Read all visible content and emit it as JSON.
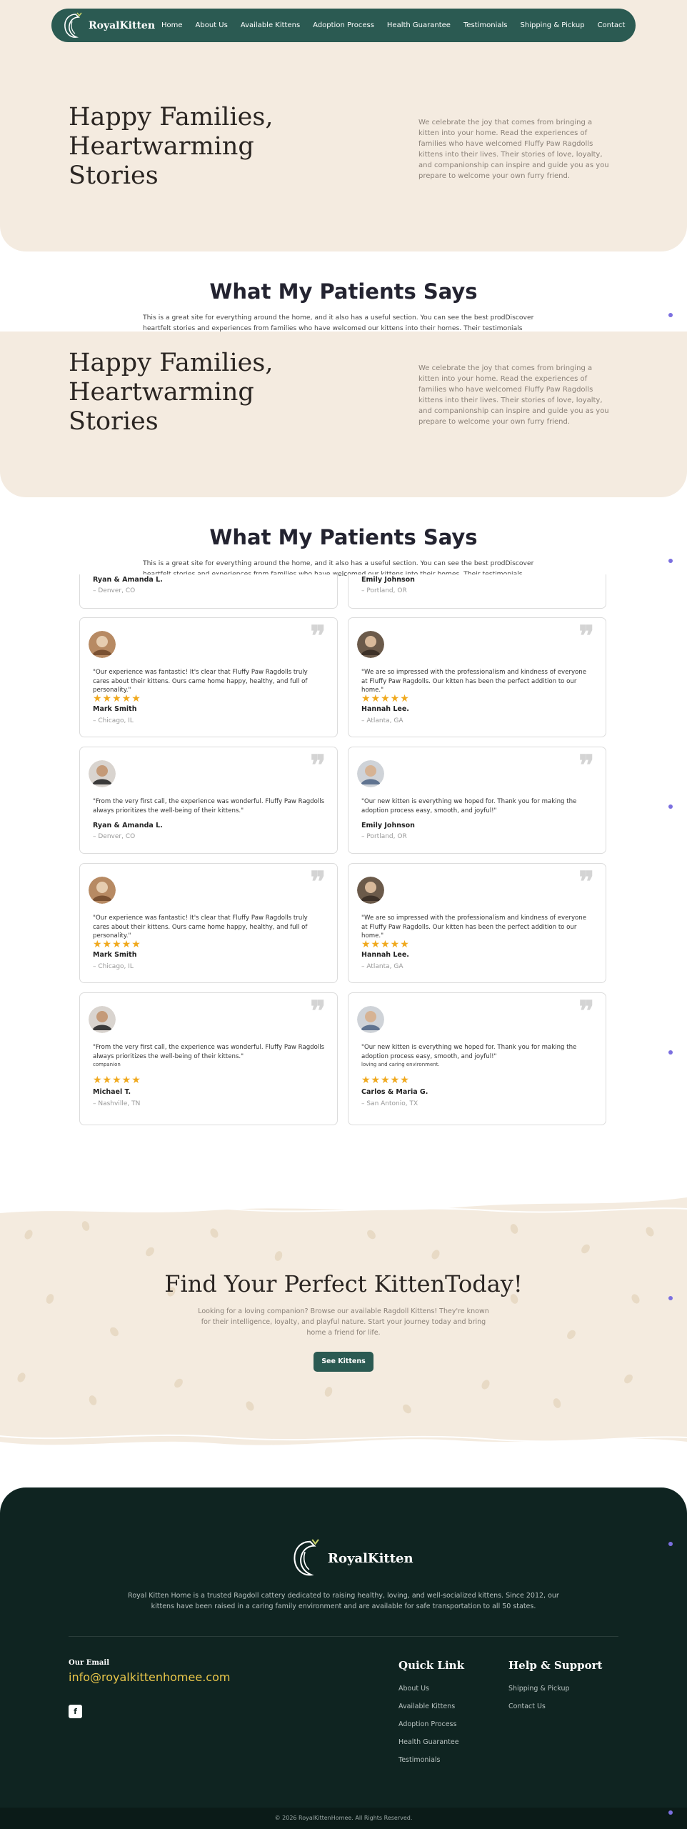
{
  "nav": {
    "brand": "RoyalKitten",
    "items": [
      "Home",
      "About Us",
      "Available Kittens",
      "Adoption Process",
      "Health Guarantee",
      "Testimonials",
      "Shipping & Pickup",
      "Contact"
    ]
  },
  "hero": {
    "title": "Happy Families, Heartwarming Stories",
    "description": "We celebrate the joy that comes from bringing a kitten into your home. Read the experiences of families who have welcomed Fluffy Paw Ragdolls kittens into their lives. Their stories of love, loyalty, and companionship can inspire and guide you as you prepare to welcome your own furry friend."
  },
  "testimonials": {
    "title": "What My Patients Says",
    "description": "This is a great site for everything around the home, and it also has a useful section. You can see the best prodDiscover heartfelt stories and experiences from families who have welcomed our kittens into their homes. Their testimonials highlight the love, joy,",
    "stars": "★★★★★",
    "quote_mark": "❞",
    "partial_top": [
      {
        "name": "Ryan & Amanda L.",
        "location": "– Denver, CO"
      },
      {
        "name": "Emily Johnson",
        "location": "– Portland, OR"
      }
    ],
    "cards": [
      {
        "text": "\"Our experience was fantastic! It's clear that Fluffy Paw Ragdolls truly cares about their kittens. Ours came home happy, healthy, and full of personality.\"",
        "name": "Mark Smith",
        "location": "– Chicago, IL"
      },
      {
        "text": "\"We are so impressed with the professionalism and kindness of everyone at Fluffy Paw Ragdolls. Our kitten has been the perfect addition to our home.\"",
        "name": "Hannah Lee.",
        "location": "– Atlanta, GA"
      },
      {
        "text": "\"From the very first call, the experience was wonderful. Fluffy Paw Ragdolls always prioritizes the well-being of their kittens.\"",
        "name": "Ryan & Amanda L.",
        "location": "– Denver, CO"
      },
      {
        "text": "\"Our new kitten is everything we hoped for. Thank you for making the adoption process easy, smooth, and joyful!\"",
        "name": "Emily Johnson",
        "location": "– Portland, OR"
      },
      {
        "text": "\"Our experience was fantastic! It's clear that Fluffy Paw Ragdolls truly cares about their kittens. Ours came home happy, healthy, and full of personality.\"",
        "name": "Mark Smith",
        "location": "– Chicago, IL"
      },
      {
        "text": "\"We are so impressed with the professionalism and kindness of everyone at Fluffy Paw Ragdolls. Our kitten has been the perfect addition to our home.\"",
        "name": "Hannah Lee.",
        "location": "– Atlanta, GA"
      },
      {
        "text": "\"From the very first call, the experience was wonderful. Fluffy Paw Ragdolls always prioritizes the well-being of their kittens.\"",
        "name": "Michael T.",
        "location": "– Nashville, TN",
        "overlap": "companion"
      },
      {
        "text": "\"Our new kitten is everything we hoped for. Thank you for making the adoption process easy, smooth, and joyful!\"",
        "name": "Carlos & Maria G.",
        "location": "– San Antonio, TX",
        "overlap": "loving and caring environment."
      }
    ]
  },
  "cta": {
    "title": "Find Your Perfect KittenToday!",
    "description": "Looking for a loving companion? Browse our available Ragdoll Kittens! They're known for their intelligence, loyalty, and playful nature. Start your journey today and bring home a friend for life.",
    "button": "See Kittens"
  },
  "footer": {
    "brand": "RoyalKitten",
    "about": "Royal Kitten Home is a trusted Ragdoll cattery dedicated to raising healthy, loving, and well-socialized kittens. Since 2012, our kittens have been raised in a caring family environment and are available for safe transportation to all 50 states.",
    "email_label": "Our Email",
    "email": "info@royalkittenhomee.com",
    "facebook": "f",
    "quick_link_title": "Quick Link",
    "quick_links": [
      "About Us",
      "Available Kittens",
      "Adoption Process",
      "Health Guarantee",
      "Testimonials"
    ],
    "help_title": "Help & Support",
    "help_links": [
      "Shipping & Pickup",
      "Contact Us"
    ],
    "copyright": "© 2026 RoyalKittenHomee. All Rights Reserved."
  },
  "colors": {
    "nav_bg": "#2b5a52",
    "cream": "#f4ebe0",
    "footer_bg": "#0f2421",
    "star": "#f0a91e",
    "email": "#e9c64a",
    "accent_dot": "#7b6fe0"
  }
}
